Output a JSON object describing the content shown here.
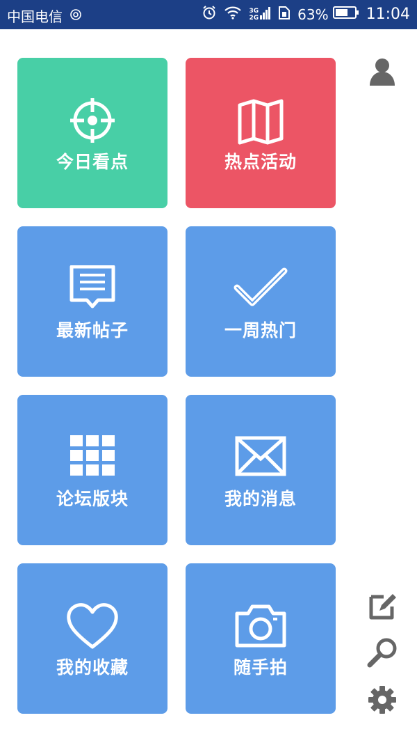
{
  "status_bar": {
    "carrier": "中国电信",
    "battery_percent": "63%",
    "time": "11:04",
    "network_top": "3G",
    "network_bottom": "2G"
  },
  "colors": {
    "status_bar": "#1c3f86",
    "tile_green": "#48cfa6",
    "tile_red": "#ec5565",
    "tile_blue": "#5d9ce8",
    "icon_gray": "#666666"
  },
  "tiles": [
    {
      "label": "今日看点",
      "icon": "crosshair-icon",
      "color": "green"
    },
    {
      "label": "热点活动",
      "icon": "map-icon",
      "color": "red"
    },
    {
      "label": "最新帖子",
      "icon": "post-bubble-icon",
      "color": "blue"
    },
    {
      "label": "一周热门",
      "icon": "checkmark-icon",
      "color": "blue"
    },
    {
      "label": "论坛版块",
      "icon": "grid-icon",
      "color": "blue"
    },
    {
      "label": "我的消息",
      "icon": "envelope-icon",
      "color": "blue"
    },
    {
      "label": "我的收藏",
      "icon": "heart-icon",
      "color": "blue"
    },
    {
      "label": "随手拍",
      "icon": "camera-icon",
      "color": "blue"
    }
  ],
  "side_buttons": [
    "user-icon",
    "edit-icon",
    "search-icon",
    "gear-icon"
  ]
}
